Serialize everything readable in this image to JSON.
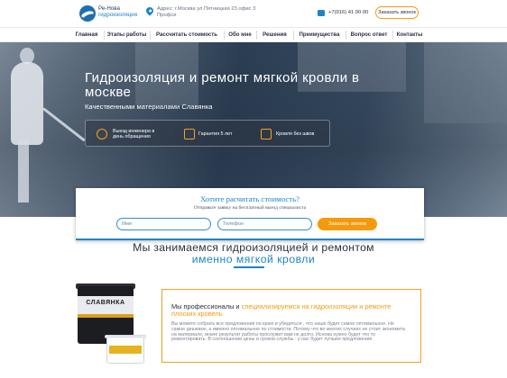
{
  "header": {
    "brand_name": "Ре-Нова",
    "brand_sub": "гидроизоляция",
    "address_line1": "Адрес: г.Москва ул.Пятницкая 23 офис 3",
    "address_line2": "Профси",
    "phone": "+7(916) 41 00 00",
    "call_button": "Заказать звонок",
    "icons": {
      "logo": "logo-icon",
      "location": "map-pin-icon",
      "phone": "phone-icon"
    }
  },
  "nav": {
    "items": [
      {
        "label": "Главная"
      },
      {
        "label": "Этапы работы"
      },
      {
        "label": "Рассчитать стоимость"
      },
      {
        "label": "Обо мне"
      },
      {
        "label": "Решения"
      },
      {
        "label": "Преимущества"
      },
      {
        "label": "Вопрос ответ"
      },
      {
        "label": "Контакты"
      }
    ]
  },
  "hero": {
    "title": "Гидроизоляция и ремонт мягкой кровли в москве",
    "subtitle": "Качественными материалами Славянка",
    "benefits": [
      {
        "icon": "engineer-icon",
        "label": "Выезд инженера в день обращения"
      },
      {
        "icon": "guarantee-icon",
        "label": "Гарантия 5 лет"
      },
      {
        "icon": "roof-icon",
        "label": "Кровля без швов"
      }
    ]
  },
  "form": {
    "title": "Хотите расчитать стоимость?",
    "note": "Отправьте заявку на бесплатный выезд специалиста",
    "name_placeholder": "Имя",
    "phone_placeholder": "Телефон",
    "submit": "Заказать звонок"
  },
  "section": {
    "line1": "Мы занимаемся гидроизоляцией и ремонтом",
    "line2": "именно мягкой кровли"
  },
  "product": {
    "bucket_label": "СЛАВЯНКА"
  },
  "info": {
    "head_prefix": "Мы профессионалы и ",
    "head_highlight": "специализируемся на гидроизоляции и ремонте плоских кровель",
    "body": "Вы можете собрать все предложения по краю и убедиться , что наше будет самое оптимальное. Не самое дешевое, а именно оптимальное по стоимости. Потому что во многих случаях не стоит экономить на материале, иначе результат работы прослужит вам не долго. Иснова нужно будет что то ремонтировать. В соотношении цены и сроков службы - у нас будет лучшее предложение."
  },
  "colors": {
    "accent": "#1e84c6",
    "brand_orange": "#f59a0c",
    "text": "#2a3140"
  }
}
